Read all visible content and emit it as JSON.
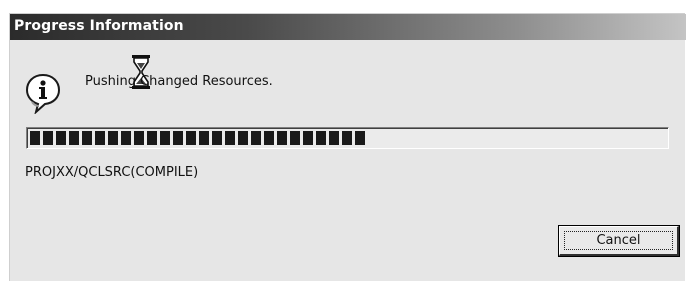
{
  "window": {
    "title": "Progress Information"
  },
  "icons": {
    "info": "info-icon",
    "busy": "hourglass-icon"
  },
  "message": "Pushing Changed Resources.",
  "progress": {
    "fraction": 0.52,
    "segments_filled": 26,
    "bar_color": "#1a1a1a"
  },
  "detail": "PROJXX/QCLSRC(COMPILE)",
  "buttons": {
    "cancel_label": "Cancel"
  },
  "colors": {
    "dialog_background": "#e6e6e6",
    "title_text": "#ffffff"
  }
}
